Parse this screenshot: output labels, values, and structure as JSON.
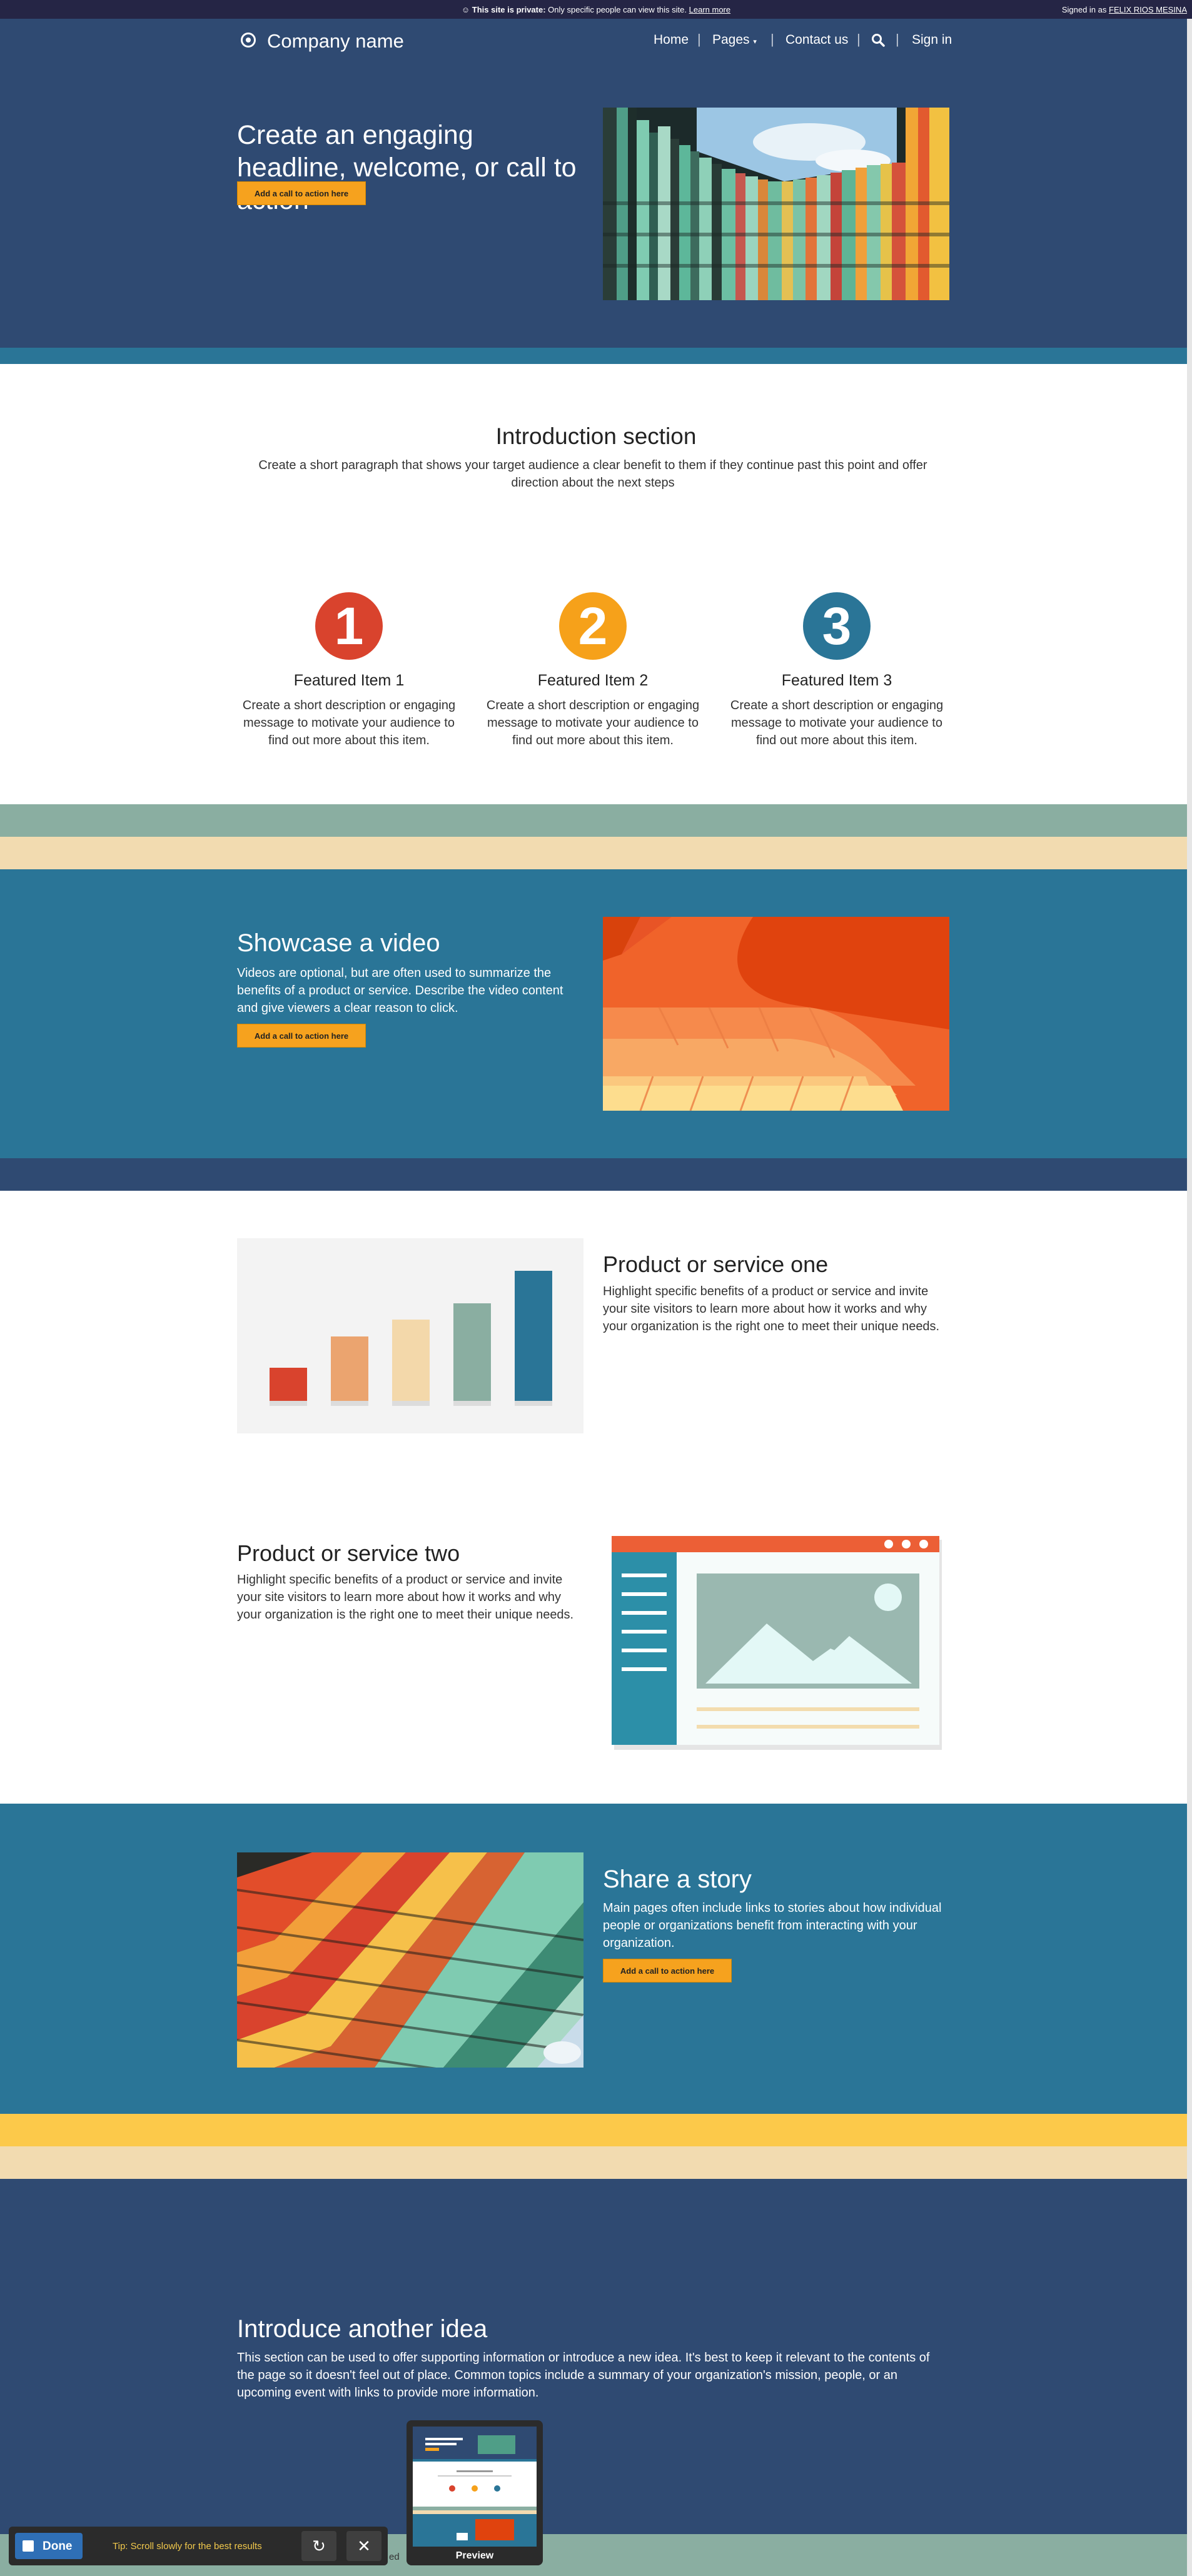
{
  "notice": {
    "private_bold": "This site is private:",
    "private_text": "Only specific people can view this site.",
    "learn_more": "Learn more",
    "signed_in_prefix": "Signed in as",
    "user": "FELIX RIOS MESINA"
  },
  "header": {
    "brand": "Company name",
    "nav": [
      "Home",
      "Pages",
      "Contact us",
      "Sign in"
    ]
  },
  "hero": {
    "headline": "Create an engaging headline, welcome, or call to action",
    "cta": "Add a call to action here"
  },
  "intro": {
    "title": "Introduction section",
    "text": "Create a short paragraph that shows your target audience a clear benefit to them if they continue past this point and offer direction about the next steps"
  },
  "features": [
    {
      "number": "1",
      "color": "#d9432d",
      "title": "Featured Item 1",
      "text": "Create a short description or engaging message to motivate your audience to find out more about this item."
    },
    {
      "number": "2",
      "color": "#f6a11a",
      "title": "Featured Item 2",
      "text": "Create a short description or engaging message to motivate your audience to find out more about this item."
    },
    {
      "number": "3",
      "color": "#2a7597",
      "title": "Featured Item 3",
      "text": "Create a short description or engaging message to motivate your audience to find out more about this item."
    }
  ],
  "video": {
    "title": "Showcase a video",
    "text": "Videos are optional, but are often used to summarize the benefits of a product or service. Describe the video content and give viewers a clear reason to click.",
    "cta": "Add a call to action here"
  },
  "product_one": {
    "title": "Product or service one",
    "text": "Highlight specific benefits of a product or service and invite your site visitors to learn more about how it works and why your organization is the right one to meet their unique needs."
  },
  "product_two": {
    "title": "Product or service two",
    "text": "Highlight specific benefits of a product or service and invite your site visitors to learn more about how it works and why your organization is the right one to meet their unique needs."
  },
  "story": {
    "title": "Share a story",
    "text": "Main pages often include links to stories about how individual people or organizations benefit from interacting with your organization.",
    "cta": "Add a call to action here"
  },
  "idea": {
    "title": "Introduce another idea",
    "text": "This section can be used to offer supporting information or introduce a new idea. It's best to keep it relevant to the contents of the page so it doesn't feel out of place. Common topics include a summary of your organization's mission, people, or an upcoming event with links to provide more information."
  },
  "capture": {
    "done": "Done",
    "tip": "Tip: Scroll slowly for the best results",
    "preview": "Preview",
    "stray": "ed"
  },
  "colors": {
    "navy": "#2f4a72",
    "teal": "#2a7597",
    "sage": "#8aaea1",
    "sand": "#f2dbb0",
    "gold": "#fcc94a",
    "orange": "#f6a21e"
  }
}
